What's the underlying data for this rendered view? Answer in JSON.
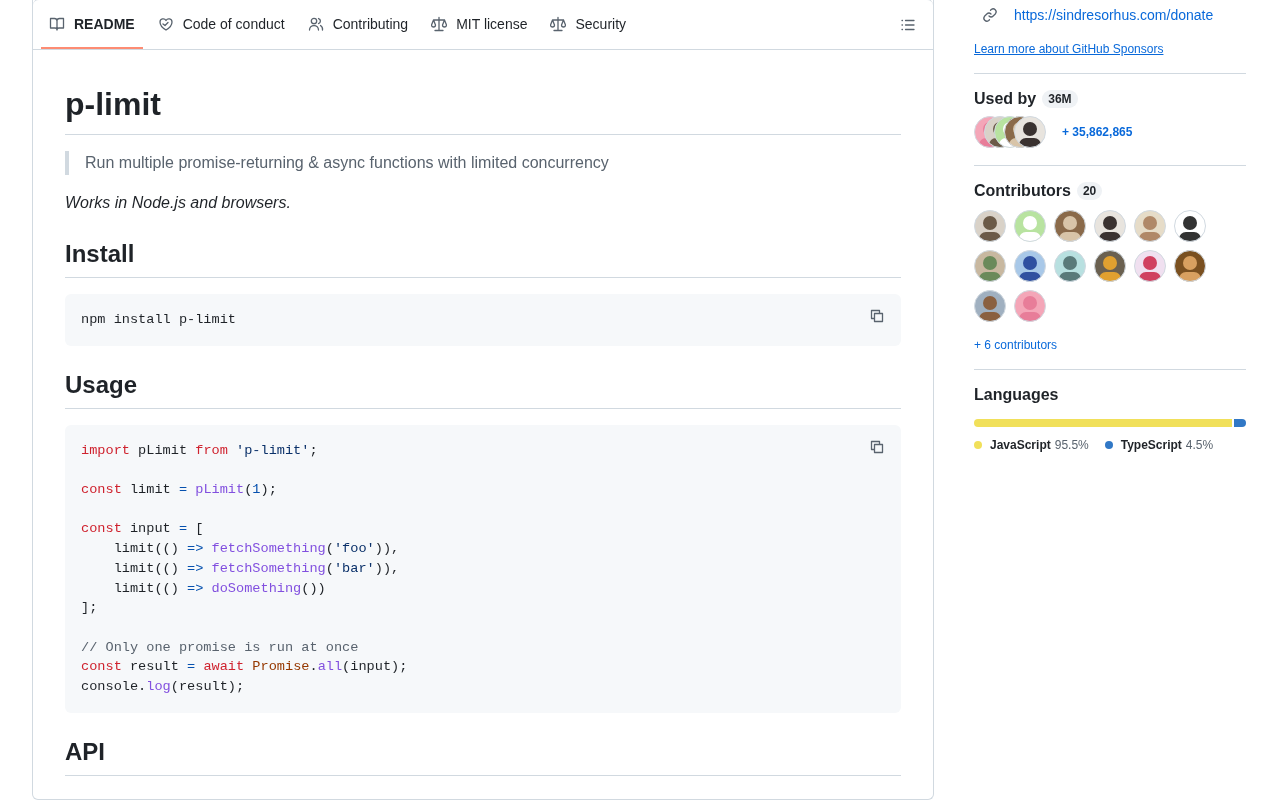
{
  "tabs": [
    {
      "label": "README",
      "kind": "book",
      "selected": true
    },
    {
      "label": "Code of conduct",
      "kind": "heart",
      "selected": false
    },
    {
      "label": "Contributing",
      "kind": "people",
      "selected": false
    },
    {
      "label": "MIT license",
      "kind": "scale",
      "selected": false
    },
    {
      "label": "Security",
      "kind": "scale",
      "selected": false
    }
  ],
  "readme": {
    "title": "p-limit",
    "quote": "Run multiple promise-returning & async functions with limited concurrency",
    "note": "Works in Node.js and browsers.",
    "install": {
      "heading": "Install",
      "code": "npm install p-limit"
    },
    "usage": {
      "heading": "Usage",
      "blocks": [
        [
          [
            {
              "text": "import",
              "kind": "keyword"
            },
            {
              "text": " pLimit ",
              "kind": "plain"
            },
            {
              "text": "from ",
              "kind": "keyword"
            },
            {
              "text": "'p-limit'",
              "kind": "string"
            },
            {
              "text": ";",
              "kind": "plain"
            }
          ]
        ],
        [
          [
            {
              "text": "const",
              "kind": "keyword"
            },
            {
              "text": " limit ",
              "kind": "plain"
            },
            {
              "text": "= ",
              "kind": "operator"
            },
            {
              "text": "pLimit",
              "kind": "func"
            },
            {
              "text": "(",
              "kind": "plain"
            },
            {
              "text": "1",
              "kind": "number"
            },
            {
              "text": ");",
              "kind": "plain"
            }
          ]
        ],
        [
          [
            {
              "text": "const",
              "kind": "keyword"
            },
            {
              "text": " input ",
              "kind": "plain"
            },
            {
              "text": "=",
              "kind": "operator"
            },
            {
              "text": " [",
              "kind": "plain"
            }
          ],
          [
            {
              "text": "    limit(() ",
              "kind": "plain"
            },
            {
              "text": "=> ",
              "kind": "operator"
            },
            {
              "text": "fetchSomething",
              "kind": "func"
            },
            {
              "text": "(",
              "kind": "plain"
            },
            {
              "text": "'foo'",
              "kind": "string"
            },
            {
              "text": ")),",
              "kind": "plain"
            }
          ],
          [
            {
              "text": "    limit(() ",
              "kind": "plain"
            },
            {
              "text": "=> ",
              "kind": "operator"
            },
            {
              "text": "fetchSomething",
              "kind": "func"
            },
            {
              "text": "(",
              "kind": "plain"
            },
            {
              "text": "'bar'",
              "kind": "string"
            },
            {
              "text": ")),",
              "kind": "plain"
            }
          ],
          [
            {
              "text": "    limit(() ",
              "kind": "plain"
            },
            {
              "text": "=> ",
              "kind": "operator"
            },
            {
              "text": "doSomething",
              "kind": "func"
            },
            {
              "text": "())",
              "kind": "plain"
            }
          ],
          [
            {
              "text": "];",
              "kind": "plain"
            }
          ]
        ],
        [
          [
            {
              "text": "// Only one promise is run at once",
              "kind": "comment"
            }
          ],
          [
            {
              "text": "const",
              "kind": "keyword"
            },
            {
              "text": " result ",
              "kind": "plain"
            },
            {
              "text": "= ",
              "kind": "operator"
            },
            {
              "text": "await ",
              "kind": "keyword"
            },
            {
              "text": "Promise",
              "kind": "builtin"
            },
            {
              "text": ".",
              "kind": "plain"
            },
            {
              "text": "all",
              "kind": "func"
            },
            {
              "text": "(input);",
              "kind": "plain"
            }
          ],
          [
            {
              "text": "console.",
              "kind": "plain"
            },
            {
              "text": "log",
              "kind": "func"
            },
            {
              "text": "(result);",
              "kind": "plain"
            }
          ]
        ]
      ]
    },
    "api": {
      "heading": "API"
    }
  },
  "sidebar": {
    "sponsor_link": "https://sindresorhus.com/donate",
    "sponsors_learn": "Learn more about GitHub Sponsors",
    "used_by": {
      "title": "Used by",
      "count": "36M",
      "more": "+ 35,862,865"
    },
    "contributors": {
      "title": "Contributors",
      "count": "20",
      "more": "+ 6 contributors"
    },
    "languages": {
      "title": "Languages",
      "items": [
        {
          "name": "JavaScript",
          "percent": "95.5%",
          "color": "#f1e05a"
        },
        {
          "name": "TypeScript",
          "percent": "4.5%",
          "color": "#3178c6"
        }
      ]
    }
  }
}
